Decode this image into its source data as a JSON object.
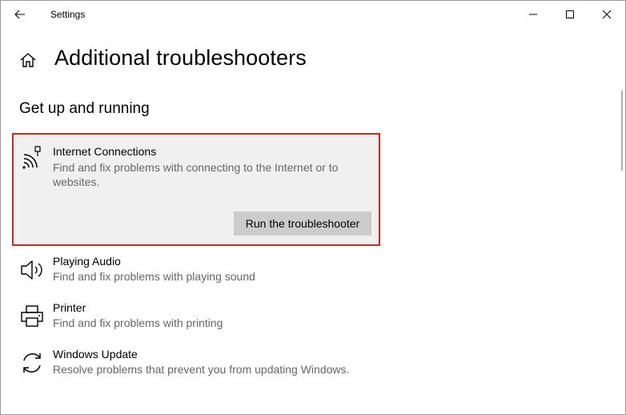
{
  "window": {
    "title": "Settings"
  },
  "header": {
    "page_title": "Additional troubleshooters",
    "section_title": "Get up and running"
  },
  "troubleshooters": [
    {
      "icon": "wifi-signal-icon",
      "title": "Internet Connections",
      "description": "Find and fix problems with connecting to the Internet or to websites.",
      "button": "Run the troubleshooter",
      "selected": true
    },
    {
      "icon": "speaker-icon",
      "title": "Playing Audio",
      "description": "Find and fix problems with playing sound"
    },
    {
      "icon": "printer-icon",
      "title": "Printer",
      "description": "Find and fix problems with printing"
    },
    {
      "icon": "sync-icon",
      "title": "Windows Update",
      "description": "Resolve problems that prevent you from updating Windows."
    }
  ],
  "colors": {
    "highlight_border": "#e0221d",
    "selected_bg": "#f0f0f0",
    "button_bg": "#cccccc",
    "description_text": "#666666"
  }
}
